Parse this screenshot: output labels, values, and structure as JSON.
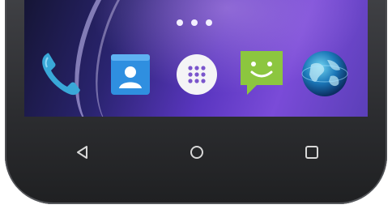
{
  "homescreen": {
    "page_indicator": {
      "count": 3
    },
    "dock": {
      "apps": [
        {
          "name": "phone-app-icon"
        },
        {
          "name": "contacts-app-icon"
        },
        {
          "name": "app-drawer-icon"
        },
        {
          "name": "messaging-app-icon"
        },
        {
          "name": "browser-globe-icon"
        }
      ]
    }
  },
  "navigation_bar": {
    "buttons": [
      {
        "icon": "back-triangle-icon"
      },
      {
        "icon": "home-circle-icon"
      },
      {
        "icon": "recents-square-icon"
      }
    ]
  },
  "colors": {
    "bezel": "#2c2d30",
    "wallpaper_accent": "#6a40c8",
    "phone_icon": "#39a8d8",
    "contacts_icon": "#2f8fe0",
    "messaging_icon": "#8cc63f",
    "nav_icon": "#d8d8d8"
  }
}
